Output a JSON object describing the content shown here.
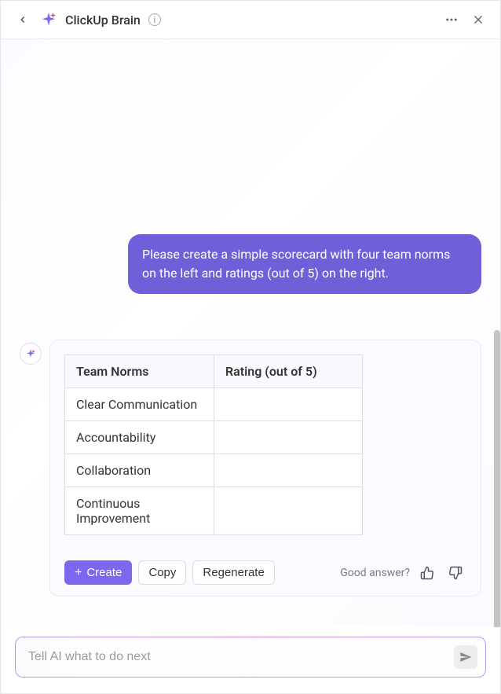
{
  "header": {
    "title": "ClickUp Brain"
  },
  "messages": {
    "user_prompt": "Please create a simple scorecard with four team norms on the left and ratings (out of 5) on the right."
  },
  "table": {
    "headers": [
      "Team Norms",
      "Rating (out of 5)"
    ],
    "rows": [
      [
        "Clear Communication",
        ""
      ],
      [
        "Accountability",
        ""
      ],
      [
        "Collaboration",
        ""
      ],
      [
        "Continuous Improvement",
        ""
      ]
    ]
  },
  "actions": {
    "create": "Create",
    "copy": "Copy",
    "regenerate": "Regenerate",
    "good_answer": "Good answer?"
  },
  "input": {
    "placeholder": "Tell AI what to do next"
  }
}
